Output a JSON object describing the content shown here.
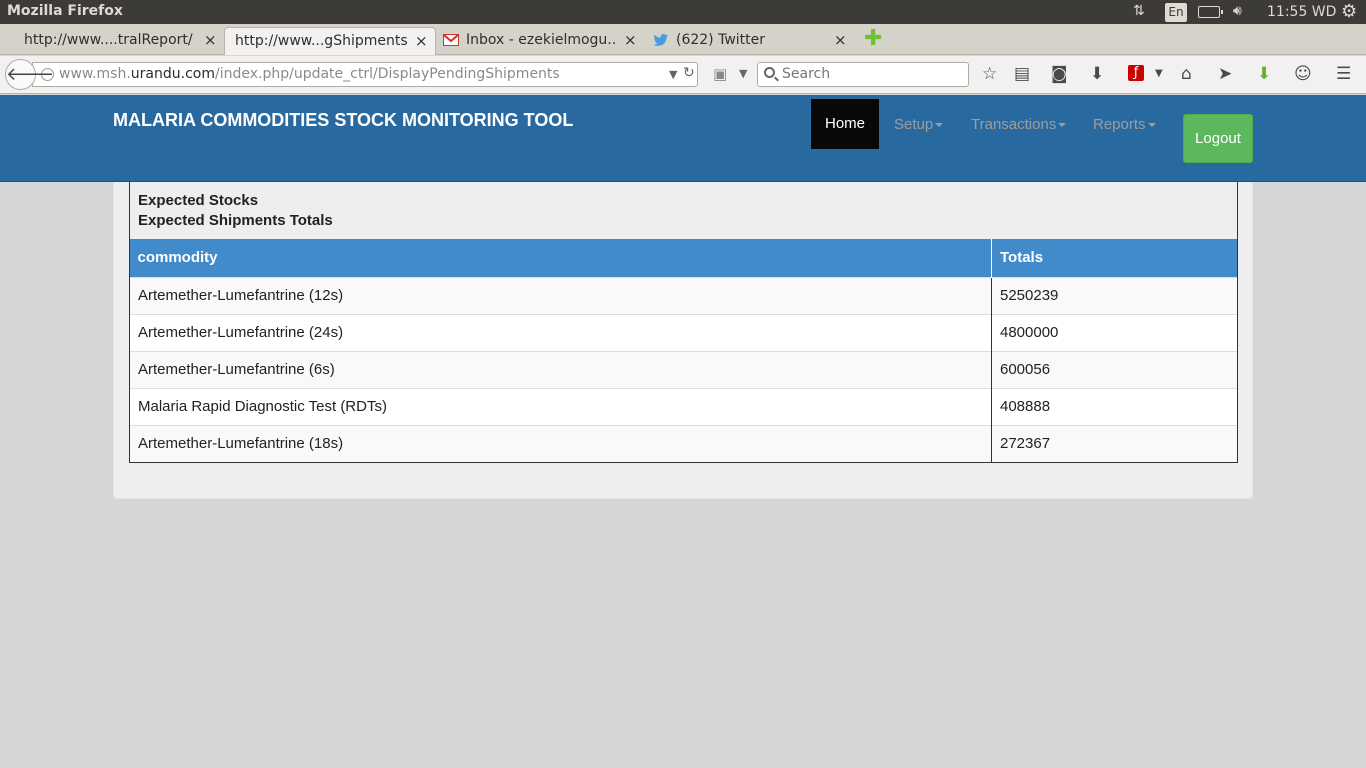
{
  "os_panel": {
    "title": "Mozilla Firefox",
    "keyboard_layout": "En",
    "clock": "11:55 WD",
    "icons": [
      "network-updown-icon",
      "battery-icon",
      "volume-icon",
      "gear-icon"
    ]
  },
  "browser": {
    "tabs": [
      {
        "label": "http://www....tralReport/",
        "active": false,
        "close": "×"
      },
      {
        "label": "http://www...gShipments",
        "active": true,
        "close": "×"
      },
      {
        "label": "Inbox - ezekielmogu...",
        "active": false,
        "close": "×",
        "icon": "gmail-icon"
      },
      {
        "label": "(622) Twitter",
        "active": false,
        "close": "×",
        "icon": "twitter-icon"
      }
    ],
    "new_tab_symbol": "✚",
    "url": {
      "prefix": "www.msh.",
      "domain": "urandu.com",
      "path": "/index.php/update_ctrl/DisplayPendingShipments"
    },
    "search_placeholder": "Search"
  },
  "site": {
    "title": "MALARIA COMMODITIES STOCK MONITORING TOOL",
    "nav": {
      "home": "Home",
      "setup": "Setup",
      "transactions": "Transactions",
      "reports": "Reports"
    },
    "logout": "Logout",
    "colors": {
      "header": "#286aa0",
      "table_header": "#428bca",
      "logout": "#5cb85c",
      "active_nav": "#080808"
    }
  },
  "panel": {
    "heading_line1": "Expected Stocks",
    "heading_line2": "Expected Shipments Totals"
  },
  "table": {
    "columns": [
      "commodity",
      "Totals"
    ],
    "rows": [
      {
        "commodity": "Artemether-Lumefantrine (12s)",
        "total": "5250239"
      },
      {
        "commodity": "Artemether-Lumefantrine (24s)",
        "total": "4800000"
      },
      {
        "commodity": "Artemether-Lumefantrine (6s)",
        "total": "600056"
      },
      {
        "commodity": "Malaria Rapid Diagnostic Test (RDTs)",
        "total": "408888"
      },
      {
        "commodity": "Artemether-Lumefantrine (18s)",
        "total": "272367"
      }
    ]
  }
}
